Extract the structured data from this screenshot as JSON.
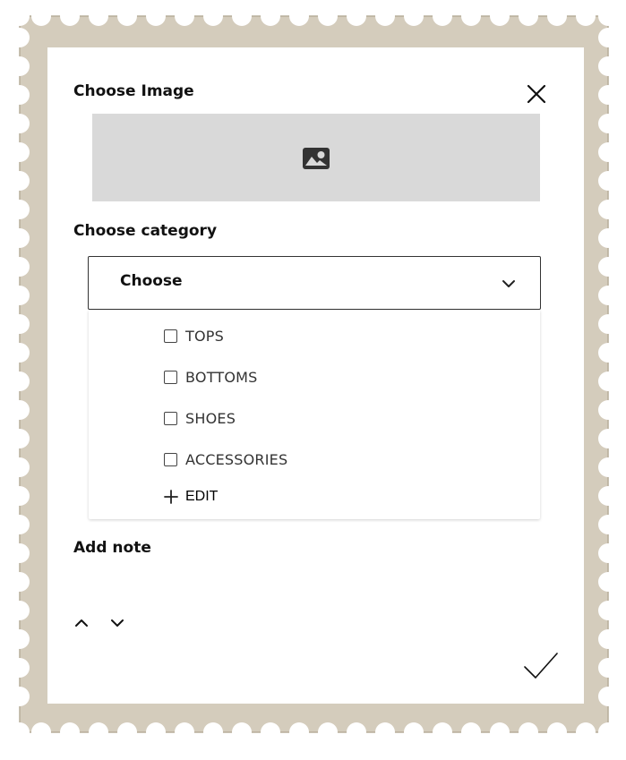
{
  "colors": {
    "stamp_border": "#d4ccbc",
    "stamp_edge": "#b7ad9a",
    "image_placeholder_bg": "#d9d9d9",
    "text_primary": "#111111",
    "text_secondary": "#333333"
  },
  "image_section": {
    "title": "Choose Image",
    "placeholder_icon": "photo-icon"
  },
  "header": {
    "close_icon": "close-icon"
  },
  "category_section": {
    "title": "Choose category",
    "select": {
      "value": "Choose",
      "icon": "chevron-down-icon"
    },
    "options": [
      {
        "label": "TOPS",
        "checked": false
      },
      {
        "label": "BOTTOMS",
        "checked": false
      },
      {
        "label": "SHOES",
        "checked": false
      },
      {
        "label": "ACCESSORIES",
        "checked": false
      }
    ],
    "edit_label": "EDIT",
    "edit_icon": "plus-icon"
  },
  "note_section": {
    "title": "Add note"
  },
  "footer": {
    "up_icon": "chevron-up-icon",
    "down_icon": "chevron-down-icon",
    "confirm_icon": "checkmark-icon"
  }
}
